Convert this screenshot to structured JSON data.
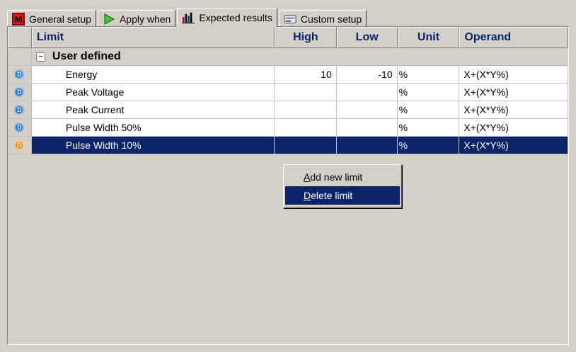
{
  "tabs": [
    {
      "label": "General setup",
      "icon": "m-logo-icon"
    },
    {
      "label": "Apply when",
      "icon": "play-arrow-icon"
    },
    {
      "label": "Expected results",
      "icon": "bar-chart-icon",
      "active": true
    },
    {
      "label": "Custom setup",
      "icon": "card-icon"
    }
  ],
  "grid": {
    "columns": {
      "limit": "Limit",
      "high": "High",
      "low": "Low",
      "unit": "Unit",
      "operand": "Operand"
    },
    "group": {
      "label": "User defined",
      "expander": "−"
    },
    "rows": [
      {
        "indicator": "D",
        "indicator_color": "#1e6fd9",
        "limit": "Energy",
        "high": "10",
        "low": "-10",
        "unit": "%",
        "operand": "X+(X*Y%)"
      },
      {
        "indicator": "D",
        "indicator_color": "#1e6fd9",
        "limit": "Peak Voltage",
        "high": "",
        "low": "",
        "unit": "%",
        "operand": "X+(X*Y%)"
      },
      {
        "indicator": "D",
        "indicator_color": "#1e6fd9",
        "limit": "Peak Current",
        "high": "",
        "low": "",
        "unit": "%",
        "operand": "X+(X*Y%)"
      },
      {
        "indicator": "D",
        "indicator_color": "#1e6fd9",
        "limit": "Pulse Width 50%",
        "high": "",
        "low": "",
        "unit": "%",
        "operand": "X+(X*Y%)"
      },
      {
        "indicator": "D",
        "indicator_color": "#f08a1c",
        "limit": "Pulse Width 10%",
        "high": "",
        "low": "",
        "unit": "%",
        "operand": "X+(X*Y%)",
        "selected": true
      }
    ]
  },
  "context_menu": {
    "add": {
      "underline": "A",
      "rest": "dd new limit"
    },
    "delete": {
      "underline": "D",
      "rest": "elete limit"
    }
  },
  "colors": {
    "selection": "#0a246a",
    "header_text": "#0a246a",
    "background": "#d4d0c8"
  }
}
